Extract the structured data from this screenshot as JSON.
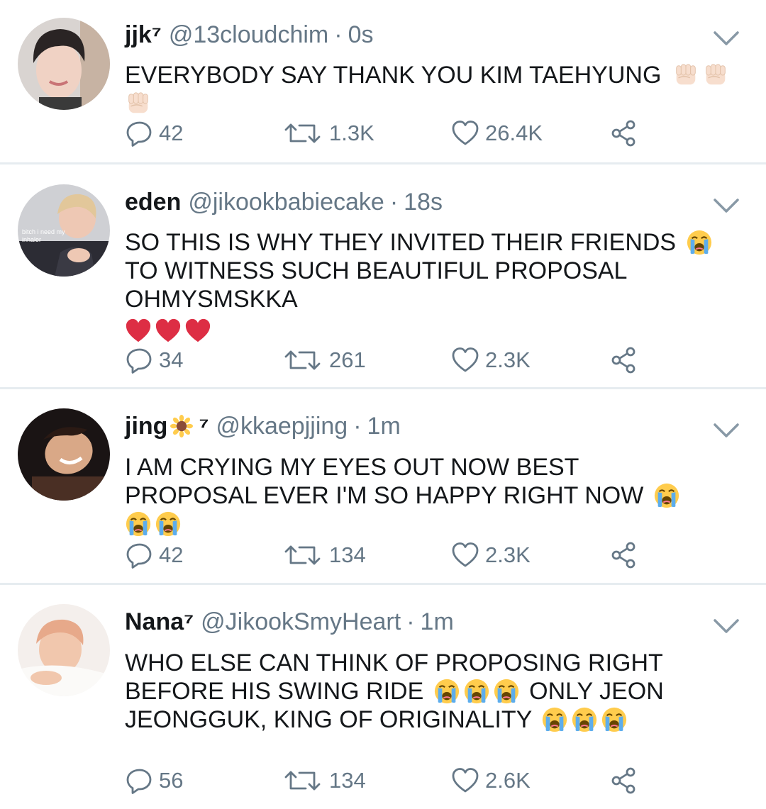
{
  "colors": {
    "text": "#14171a",
    "secondary": "#657786",
    "divider": "#e6ecf0"
  },
  "tweets": [
    {
      "name": "jjk⁷",
      "handle": "@13cloudchim",
      "time": "0s",
      "text": [
        "EVERYBODY SAY THANK YOU KIM TAEHYUNG"
      ],
      "emoji": [
        "raised-fist-light",
        "raised-fist-light",
        "raised-fist-light"
      ],
      "stats": {
        "replies": "42",
        "retweets": "1.3K",
        "likes": "26.4K"
      }
    },
    {
      "name": "eden",
      "handle": "@jikookbabiecake",
      "time": "18s",
      "avatar_caption": "bitch i need my inhaler",
      "text": [
        "SO THIS IS WHY THEY INVITED THEIR FRIENDS",
        "TO WITNESS SUCH BEAUTIFUL PROPOSAL OHMYSMSKKA"
      ],
      "emoji": [
        "loudly-crying-face",
        "red-heart",
        "red-heart",
        "red-heart"
      ],
      "stats": {
        "replies": "34",
        "retweets": "261",
        "likes": "2.3K"
      }
    },
    {
      "name": "jing",
      "name_badge": "sunflower",
      "name_suffix": "⁷",
      "handle": "@kkaepjjing",
      "time": "1m",
      "text": [
        "I AM CRYING MY EYES OUT NOW BEST PROPOSAL EVER I'M SO HAPPY RIGHT NOW"
      ],
      "emoji": [
        "loudly-crying-face",
        "loudly-crying-face",
        "loudly-crying-face"
      ],
      "stats": {
        "replies": "42",
        "retweets": "134",
        "likes": "2.3K"
      }
    },
    {
      "name": "Nana⁷",
      "handle": "@JikookSmyHeart",
      "time": "1m",
      "text": [
        "WHO ELSE CAN THINK OF PROPOSING RIGHT BEFORE HIS SWING RIDE",
        "ONLY JEON JEONGGUK, KING OF ORIGINALITY"
      ],
      "emoji": [
        "loudly-crying-face",
        "loudly-crying-face",
        "loudly-crying-face",
        "loudly-crying-face",
        "loudly-crying-face",
        "loudly-crying-face"
      ],
      "stats": {
        "replies": "56",
        "retweets": "134",
        "likes": "2.6K"
      }
    }
  ],
  "icons": {
    "reply": "reply-icon",
    "retweet": "retweet-icon",
    "like": "like-icon",
    "share": "share-icon",
    "menu": "chevron-down-icon"
  }
}
